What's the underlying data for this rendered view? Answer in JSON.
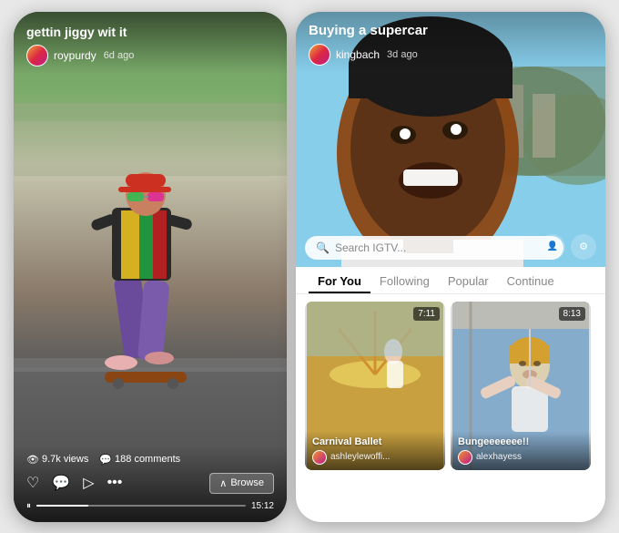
{
  "left_phone": {
    "video_title": "gettin jiggy wit it",
    "username": "roypurdy",
    "time_ago": "6d ago",
    "stats": {
      "views": "9.7k views",
      "comments": "188 comments"
    },
    "duration": "15:12",
    "browse_label": "Browse",
    "progress_percent": 25
  },
  "right_phone": {
    "hero_title": "Buying a supercar",
    "username": "kingbach",
    "time_ago": "3d ago",
    "search_placeholder": "Search IGTV...",
    "tabs": [
      {
        "label": "For You",
        "active": true
      },
      {
        "label": "Following",
        "active": false
      },
      {
        "label": "Popular",
        "active": false
      },
      {
        "label": "Continue",
        "active": false
      }
    ],
    "thumbnails": [
      {
        "title": "Carnival Ballet",
        "username": "ashleylewoffi...",
        "duration": "7:11",
        "theme": "warm"
      },
      {
        "title": "Bungeeeeeee!!",
        "username": "alexhayess",
        "duration": "8:13",
        "theme": "cool"
      },
      {
        "title": "",
        "username": "",
        "duration": "",
        "theme": "hot"
      }
    ]
  }
}
